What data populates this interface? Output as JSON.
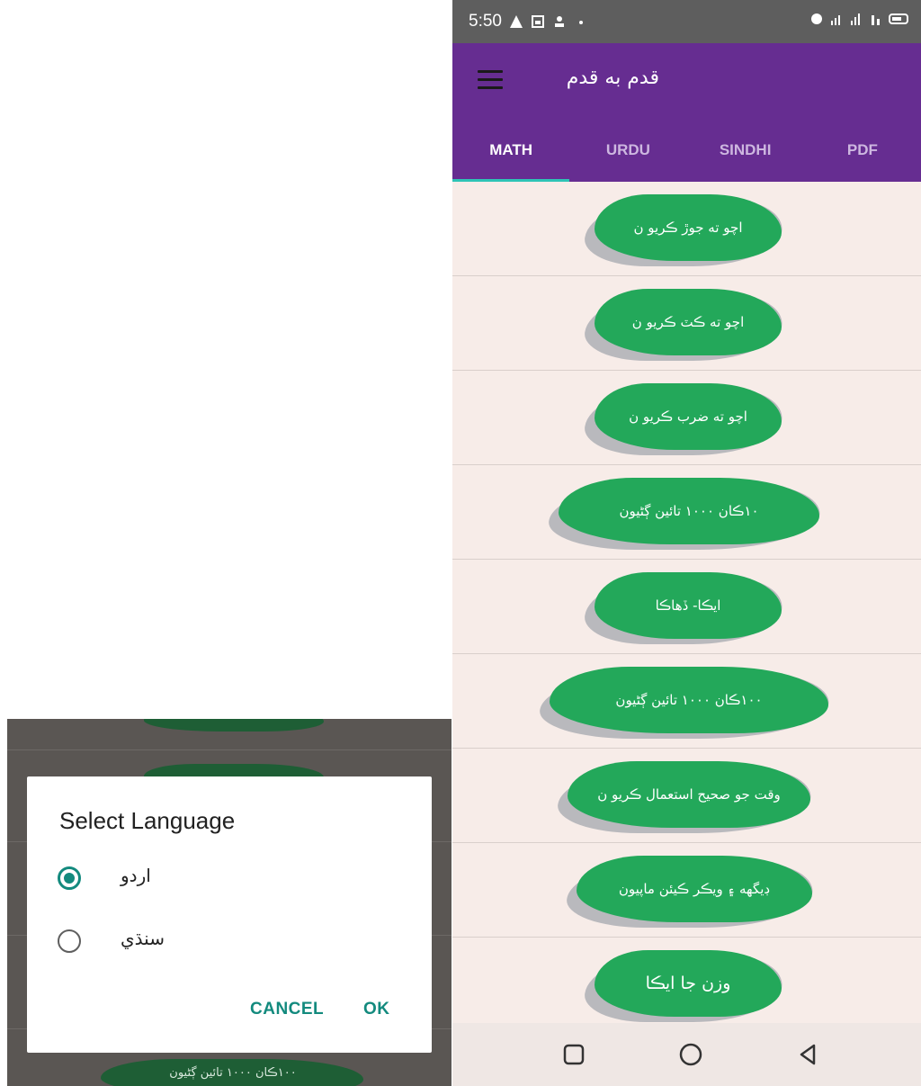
{
  "status_bar": {
    "time": "5:50",
    "left_icons": [
      "warning-icon",
      "image-icon",
      "person-icon",
      "dot-icon"
    ],
    "right_icons": [
      "alarm-icon",
      "signal-icon",
      "signal-icon",
      "wifi-icon",
      "battery-icon"
    ]
  },
  "app_bar": {
    "title": "قدم به قدم",
    "menu_icon": "hamburger-icon",
    "background": "#662d91"
  },
  "tabs": [
    {
      "label": "MATH",
      "active": true
    },
    {
      "label": "URDU",
      "active": false
    },
    {
      "label": "SINDHI",
      "active": false
    },
    {
      "label": "PDF",
      "active": false
    }
  ],
  "lessons": [
    {
      "label": "اچو ته جوڙ ڪريو ن"
    },
    {
      "label": "اچو ته ڪٽ ڪريو ن"
    },
    {
      "label": "اچو ته ضرب ڪريو ن"
    },
    {
      "label": "١٠ڪان ١٠٠٠ تائين ڳڻيون"
    },
    {
      "label": "ايڪا- ڏهاڪا"
    },
    {
      "label": "١٠٠ڪان ١٠٠٠ تائين ڳڻيون"
    },
    {
      "label": "وقت جو صحيح استعمال ڪريو ن"
    },
    {
      "label": "ڊيگهه ۽ ويڪر ڪيئن ماپيون"
    },
    {
      "label": "وزن جا ايڪا"
    }
  ],
  "nav_bar": {
    "icons": [
      "recents-square-icon",
      "home-circle-icon",
      "back-triangle-icon"
    ]
  },
  "dialog": {
    "title": "Select Language",
    "options": [
      {
        "label": "اردو",
        "selected": true
      },
      {
        "label": "سنڌي",
        "selected": false
      }
    ],
    "cancel_label": "CANCEL",
    "ok_label": "OK",
    "accent": "#138a7e"
  },
  "dialog_background": {
    "lesson_text": "١٠٠ڪان ١٠٠٠ تائين ڳڻيون"
  },
  "colors": {
    "brush_green": "#23a85a",
    "list_background": "#f7ece8"
  }
}
